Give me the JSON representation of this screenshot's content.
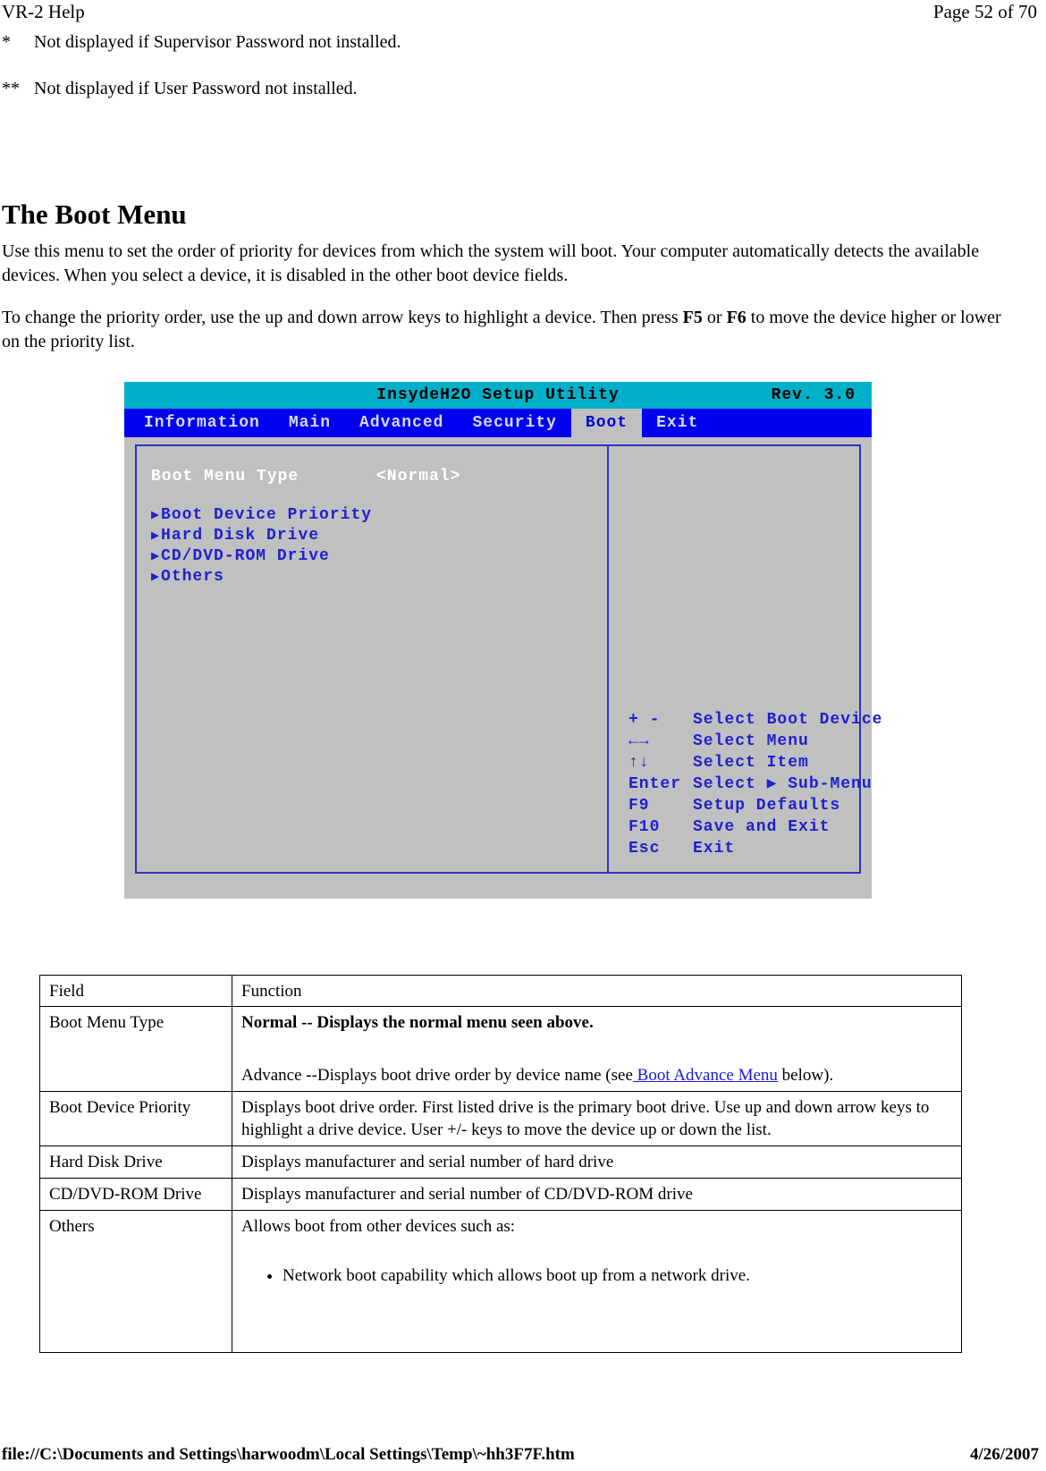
{
  "header": {
    "doc_title": "VR-2 Help",
    "page_indicator": "Page 52 of 70"
  },
  "footnotes": [
    {
      "mark": "*",
      "text": "Not displayed if Supervisor Password not installed."
    },
    {
      "mark": "**",
      "text": "Not displayed if User Password not installed."
    }
  ],
  "section": {
    "heading": "The Boot Menu",
    "paragraph1": "Use this menu to set the order of priority for devices from which the system will boot. Your computer automatically detects the available devices. When you select a device, it is disabled in the other boot device fields.",
    "paragraph2_part1": "To change the priority order, use the up and down arrow keys to highlight a device.  Then press ",
    "paragraph2_key1": "F5",
    "paragraph2_part2": " or ",
    "paragraph2_key2": "F6",
    "paragraph2_part3": " to move the device higher or lower on the priority list."
  },
  "bios": {
    "title": "InsydeH2O Setup Utility",
    "revision": "Rev. 3.0",
    "tabs": [
      {
        "label": "Information",
        "active": false
      },
      {
        "label": "Main",
        "active": false
      },
      {
        "label": "Advanced",
        "active": false
      },
      {
        "label": "Security",
        "active": false
      },
      {
        "label": "Boot",
        "active": true
      },
      {
        "label": "Exit",
        "active": false
      }
    ],
    "setting": {
      "label": "Boot Menu Type",
      "value": "<Normal>"
    },
    "submenus": [
      {
        "marker": "▶",
        "label": "Boot Device Priority"
      },
      {
        "marker": "▶",
        "label": "Hard Disk Drive"
      },
      {
        "marker": "▶",
        "label": "CD/DVD-ROM Drive"
      },
      {
        "marker": "▶",
        "label": "Others"
      }
    ],
    "key_help": [
      {
        "key": "+ -",
        "desc": "Select Boot Device"
      },
      {
        "key": "←→",
        "desc": "Select Menu"
      },
      {
        "key": "↑↓",
        "desc": "Select Item"
      },
      {
        "key": "Enter",
        "desc": "Select ▶ Sub-Menu"
      },
      {
        "key": "F9",
        "desc": "Setup Defaults"
      },
      {
        "key": "F10",
        "desc": "Save and Exit"
      },
      {
        "key": "Esc",
        "desc": "Exit"
      }
    ],
    "colors": {
      "title_bar": "#00b0c8",
      "menu_bar": "#0000f0",
      "panel": "#c0c0c0",
      "border": "#3030c0",
      "submenu_text": "#2020d0",
      "setting_text": "#ffffff"
    }
  },
  "table": {
    "headers": {
      "field": "Field",
      "function": "Function"
    },
    "rows": [
      {
        "field": "Boot Menu Type",
        "function_bold": "Normal -- Displays the normal menu seen above.",
        "function_pre_link": "Advance --Displays boot drive order by device name (see",
        "function_link": " Boot Advance Menu",
        "function_post_link": " below)."
      },
      {
        "field": "Boot Device Priority",
        "function": "Displays boot drive order.  First listed drive is the primary boot drive.  Use up and down arrow keys to highlight a drive device.  User +/- keys to move the device up or down the list."
      },
      {
        "field": "Hard Disk Drive",
        "function": "Displays manufacturer and serial number of hard drive"
      },
      {
        "field": "CD/DVD-ROM Drive",
        "function": "Displays manufacturer and serial number of CD/DVD-ROM drive"
      },
      {
        "field": "Others",
        "function": "Allows boot from other devices such as:",
        "bullets": [
          "Network boot capability which allows boot up from a network drive."
        ]
      }
    ]
  },
  "footer": {
    "path": "file://C:\\Documents and Settings\\harwoodm\\Local Settings\\Temp\\~hh3F7F.htm",
    "date": "4/26/2007"
  }
}
